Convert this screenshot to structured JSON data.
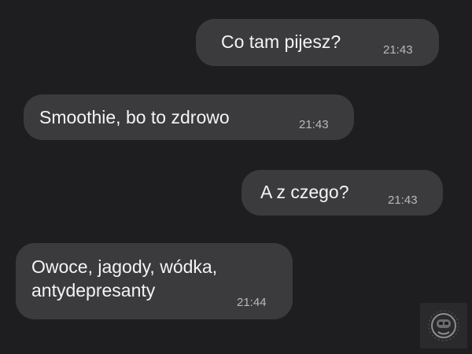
{
  "conversation": {
    "messages": [
      {
        "direction": "outgoing",
        "text": "Co tam pijesz?",
        "time": "21:43"
      },
      {
        "direction": "incoming",
        "text": "Smoothie, bo to zdrowo",
        "time": "21:43"
      },
      {
        "direction": "outgoing",
        "text": "A z czego?",
        "time": "21:43"
      },
      {
        "direction": "incoming",
        "text": "Owoce, jagody, wódka, antydepresanty",
        "time": "21:44"
      }
    ]
  },
  "watermark": {
    "icon": "astronaut-helmet-icon"
  },
  "colors": {
    "background": "#1e1e20",
    "bubble": "#3b3b3d",
    "text": "#f4f4f4",
    "timestamp": "#b9b9bb"
  }
}
